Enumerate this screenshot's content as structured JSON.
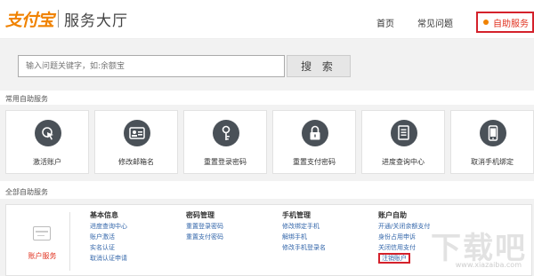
{
  "header": {
    "logo_mark": "支付宝",
    "logo_sub": "服务大厅",
    "nav": [
      {
        "label": "首页"
      },
      {
        "label": "常见问题"
      },
      {
        "label": "自助服务"
      }
    ]
  },
  "search": {
    "placeholder": "输入问题关键字，如:余额宝",
    "button_label": "搜 索"
  },
  "common": {
    "title": "常用自助服务",
    "tiles": [
      {
        "label": "激活账户",
        "icon": "cursor-icon"
      },
      {
        "label": "修改邮箱名",
        "icon": "id-card-icon"
      },
      {
        "label": "重置登录密码",
        "icon": "key-icon"
      },
      {
        "label": "重置支付密码",
        "icon": "lock-icon"
      },
      {
        "label": "进度查询中心",
        "icon": "document-icon"
      },
      {
        "label": "取消手机绑定",
        "icon": "phone-icon"
      }
    ]
  },
  "all": {
    "title": "全部自助服务",
    "account_label": "账户服务",
    "columns": [
      {
        "title": "基本信息",
        "links": [
          "进度查询中心",
          "账户激活",
          "实名认证",
          "取消认证申请"
        ]
      },
      {
        "title": "密码管理",
        "links": [
          "重置登录密码",
          "重置支付密码"
        ]
      },
      {
        "title": "手机管理",
        "links": [
          "修改绑定手机",
          "解绑手机",
          "修改手机登录名"
        ]
      },
      {
        "title": "账户自助",
        "links": [
          "开通/关闭余额支付",
          "身份占用申诉",
          "关闭信用支付",
          "注销账户"
        ]
      }
    ]
  },
  "watermark": {
    "text": "下载吧",
    "url": "www.xiazaiba.com"
  },
  "colors": {
    "brand": "#f08200",
    "highlight": "#d4212b",
    "icon_bg": "#4a5158",
    "link": "#3366aa"
  }
}
